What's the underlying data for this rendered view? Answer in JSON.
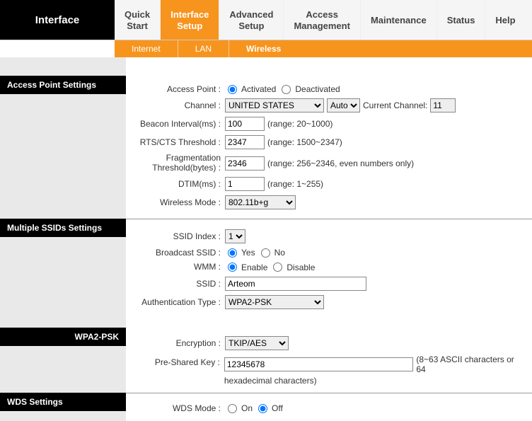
{
  "brand": "Interface",
  "tabs": {
    "quick": "Quick\nStart",
    "iface": "Interface\nSetup",
    "adv": "Advanced\nSetup",
    "access": "Access\nManagement",
    "maint": "Maintenance",
    "status": "Status",
    "help": "Help"
  },
  "subtabs": {
    "internet": "Internet",
    "lan": "LAN",
    "wireless": "Wireless"
  },
  "sections": {
    "ap": "Access Point Settings",
    "ssid": "Multiple SSIDs Settings",
    "wpa": "WPA2-PSK",
    "wds": "WDS Settings"
  },
  "ap": {
    "label": "Access Point :",
    "activated": "Activated",
    "deactivated": "Deactivated",
    "channel_label": "Channel :",
    "country": "UNITED STATES",
    "auto": "Auto",
    "cc_label": "Current Channel:",
    "cc_value": "11",
    "beacon_label": "Beacon Interval(ms) :",
    "beacon_value": "100",
    "beacon_hint": "(range: 20~1000)",
    "rts_label": "RTS/CTS Threshold :",
    "rts_value": "2347",
    "rts_hint": "(range: 1500~2347)",
    "frag_label": "Fragmentation Threshold(bytes) :",
    "frag_value": "2346",
    "frag_hint": "(range: 256~2346, even numbers only)",
    "dtim_label": "DTIM(ms) :",
    "dtim_value": "1",
    "dtim_hint": "(range: 1~255)",
    "mode_label": "Wireless Mode :",
    "mode_value": "802.11b+g"
  },
  "ssid": {
    "index_label": "SSID Index :",
    "index_value": "1",
    "broadcast_label": "Broadcast SSID :",
    "yes": "Yes",
    "no": "No",
    "wmm_label": "WMM :",
    "enable": "Enable",
    "disable": "Disable",
    "ssid_label": "SSID :",
    "ssid_value": "Arteom",
    "auth_label": "Authentication Type :",
    "auth_value": "WPA2-PSK"
  },
  "wpa": {
    "enc_label": "Encryption :",
    "enc_value": "TKIP/AES",
    "psk_label": "Pre-Shared Key :",
    "psk_value": "12345678",
    "psk_hint1": "(8~63 ASCII characters or 64",
    "psk_hint2": "hexadecimal characters)"
  },
  "wds": {
    "mode_label": "WDS Mode :",
    "on": "On",
    "off": "Off"
  }
}
